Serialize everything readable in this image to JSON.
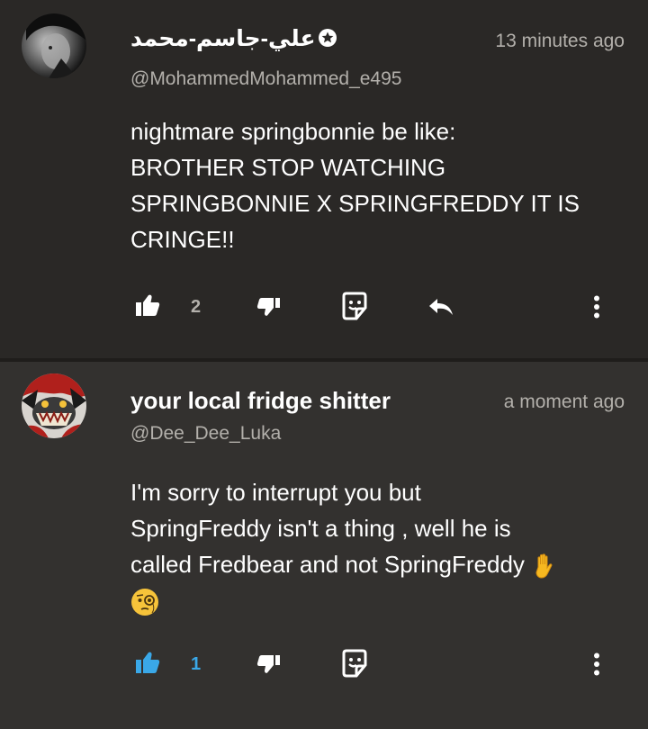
{
  "comments": [
    {
      "author": "علي-جاسم-محمد",
      "handle": "@MohammedMohammed_e495",
      "time": "13 minutes ago",
      "text_lines": [
        "nightmare springbonnie be like:",
        "BROTHER STOP WATCHING",
        "SPRINGBONNIE X SPRINGFREDDY IT IS",
        "CRINGE!!"
      ],
      "likes": "2",
      "liked": false,
      "icons": [
        "verified-star-icon",
        "like-icon",
        "dislike-icon",
        "sticker-icon",
        "reply-icon",
        "more-vertical-icon"
      ]
    },
    {
      "author": "your local fridge shitter",
      "handle": "@Dee_Dee_Luka",
      "time": "a moment ago",
      "text_lines": [
        "I'm sorry to interrupt you but",
        "SpringFreddy isn't a thing , well he is",
        "called Fredbear and not SpringFreddy"
      ],
      "emojis": [
        "raised-hand-emoji",
        "monocle-face-emoji"
      ],
      "likes": "1",
      "liked": true,
      "icons": [
        "like-icon",
        "dislike-icon",
        "sticker-icon",
        "more-vertical-icon"
      ]
    }
  ],
  "colors": {
    "background": "#2a2826",
    "background_alt": "#33312f",
    "secondary_text": "#b3b0ab",
    "accent_blue": "#3aa8e8"
  }
}
